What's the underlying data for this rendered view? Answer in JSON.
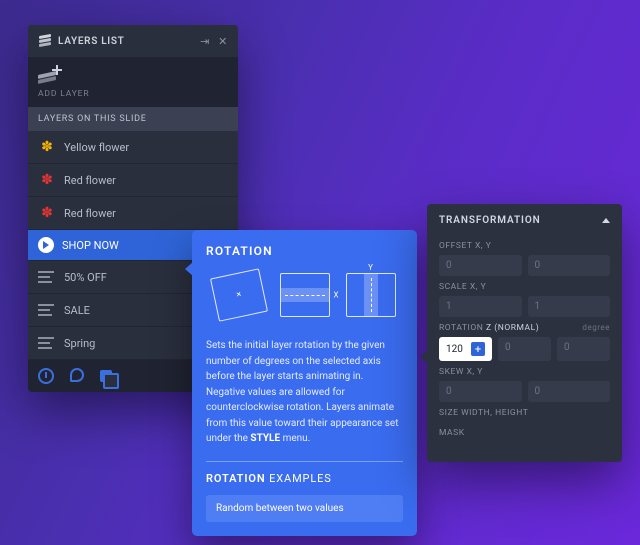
{
  "layers_panel": {
    "title": "LAYERS LIST",
    "add_layer_label": "ADD LAYER",
    "section_label": "LAYERS ON THIS SLIDE",
    "items": [
      {
        "label": "Yellow flower",
        "thumb": "flower-y",
        "selected": false
      },
      {
        "label": "Red flower",
        "thumb": "flower-r",
        "selected": false
      },
      {
        "label": "Red flower",
        "thumb": "flower-r",
        "selected": false
      },
      {
        "label": "SHOP NOW",
        "thumb": "btn",
        "selected": true
      },
      {
        "label": "50% OFF",
        "thumb": "text",
        "selected": false
      },
      {
        "label": "SALE",
        "thumb": "text",
        "selected": false
      },
      {
        "label": "Spring",
        "thumb": "text",
        "selected": false
      }
    ]
  },
  "rotation_tip": {
    "title": "ROTATION",
    "body": "Sets the initial layer rotation by the given number of degrees on the selected axis before the layer starts animating in. Negative values are allowed for counterclockwise rotation. Layers animate from this value toward their appearance set under the ",
    "body_bold": "STYLE",
    "body_tail": " menu.",
    "examples_heading_bold": "ROTATION",
    "examples_heading_rest": " EXAMPLES",
    "example_button": "Random between two values"
  },
  "transform_panel": {
    "title": "TRANSFORMATION",
    "groups": {
      "offset": {
        "label_main": "OFFSET ",
        "label_dim": "X, Y",
        "values": [
          "0",
          "0"
        ]
      },
      "scale": {
        "label_main": "SCALE ",
        "label_dim": "X, Y",
        "values": [
          "1",
          "1"
        ]
      },
      "rotation": {
        "label_main": "ROTATION ",
        "label_em": "Z (NORMAL)",
        "unit": "degree",
        "values": [
          "120",
          "0",
          "0"
        ],
        "active_index": 0
      },
      "skew": {
        "label_main": "SKEW ",
        "label_dim": "X, Y",
        "values": [
          "0",
          "0"
        ]
      },
      "size": {
        "label_main": "SIZE ",
        "label_dim": "WIDTH, HEIGHT"
      },
      "mask": {
        "label_main": "MASK"
      }
    }
  }
}
